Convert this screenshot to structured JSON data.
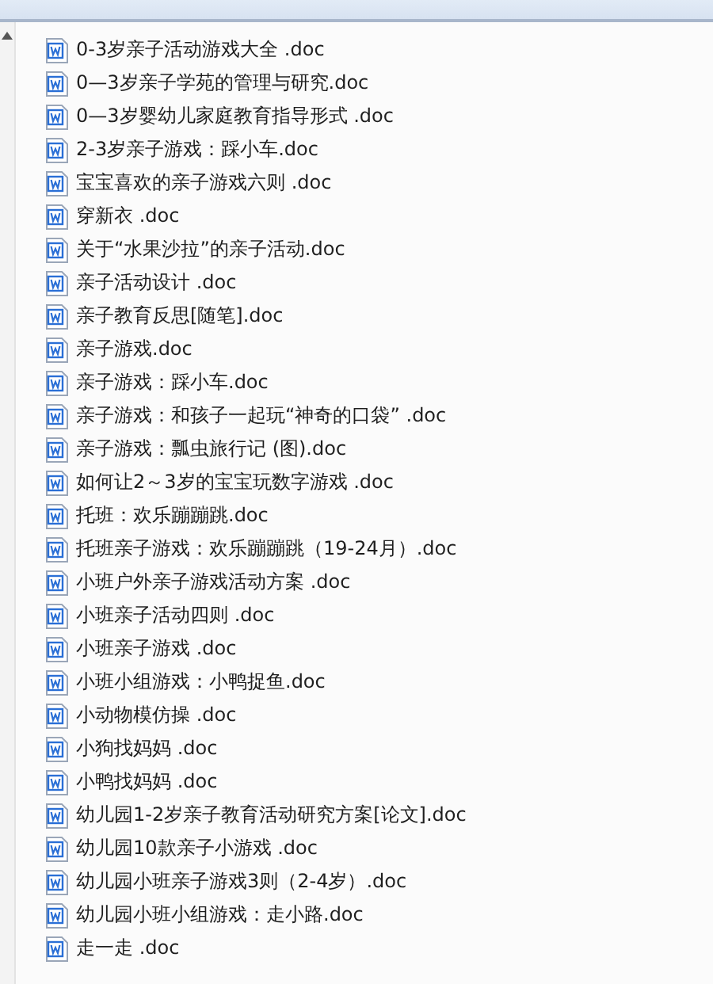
{
  "files": [
    {
      "name": "0-3岁亲子活动游戏大全 .doc"
    },
    {
      "name": "0—3岁亲子学苑的管理与研究.doc"
    },
    {
      "name": "0—3岁婴幼儿家庭教育指导形式 .doc"
    },
    {
      "name": "2-3岁亲子游戏：踩小车.doc"
    },
    {
      "name": "宝宝喜欢的亲子游戏六则 .doc"
    },
    {
      "name": "穿新衣 .doc"
    },
    {
      "name": "关于“水果沙拉”的亲子活动.doc"
    },
    {
      "name": "亲子活动设计 .doc"
    },
    {
      "name": "亲子教育反思[随笔].doc"
    },
    {
      "name": "亲子游戏.doc"
    },
    {
      "name": "亲子游戏：踩小车.doc"
    },
    {
      "name": "亲子游戏：和孩子一起玩“神奇的口袋” .doc"
    },
    {
      "name": "亲子游戏：瓢虫旅行记 (图).doc"
    },
    {
      "name": "如何让2～3岁的宝宝玩数字游戏 .doc"
    },
    {
      "name": "托班：欢乐蹦蹦跳.doc"
    },
    {
      "name": "托班亲子游戏：欢乐蹦蹦跳（19-24月）.doc"
    },
    {
      "name": "小班户外亲子游戏活动方案 .doc"
    },
    {
      "name": "小班亲子活动四则 .doc"
    },
    {
      "name": "小班亲子游戏 .doc"
    },
    {
      "name": "小班小组游戏：小鸭捉鱼.doc"
    },
    {
      "name": "小动物模仿操  .doc"
    },
    {
      "name": "小狗找妈妈 .doc"
    },
    {
      "name": "小鸭找妈妈 .doc"
    },
    {
      "name": "幼儿园1-2岁亲子教育活动研究方案[论文].doc"
    },
    {
      "name": "幼儿园10款亲子小游戏 .doc"
    },
    {
      "name": "幼儿园小班亲子游戏3则（2-4岁）.doc"
    },
    {
      "name": "幼儿园小班小组游戏：走小路.doc"
    },
    {
      "name": "走一走 .doc"
    }
  ]
}
